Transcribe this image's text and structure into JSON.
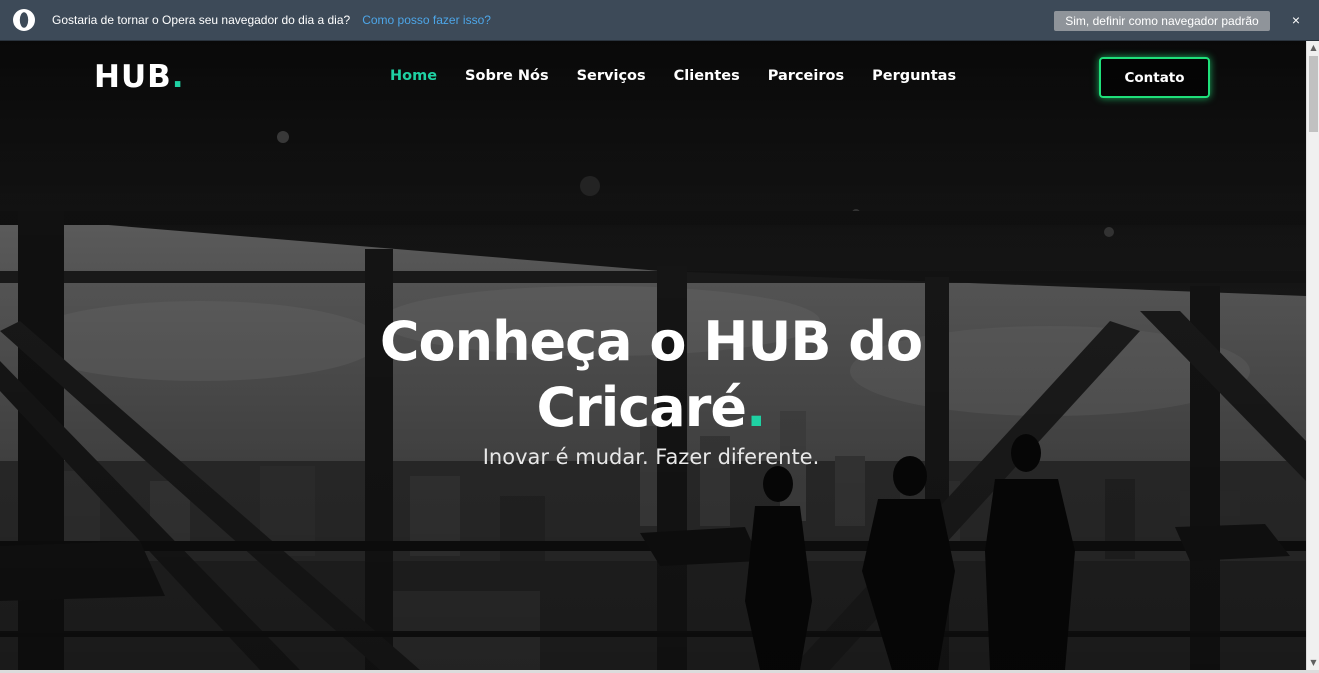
{
  "infobar": {
    "message": "Gostaria de tornar o Opera seu navegador do dia a dia?",
    "link": "Como posso fazer isso?",
    "button": "Sim, definir como navegador padrão",
    "close": "×",
    "icon": "opera-logo-icon"
  },
  "navbar": {
    "logo_text": "HUB",
    "logo_dot": ".",
    "links": [
      {
        "label": "Home",
        "active": true
      },
      {
        "label": "Sobre Nós",
        "active": false
      },
      {
        "label": "Serviços",
        "active": false
      },
      {
        "label": "Clientes",
        "active": false
      },
      {
        "label": "Parceiros",
        "active": false
      },
      {
        "label": "Perguntas",
        "active": false
      }
    ],
    "contact": "Contato"
  },
  "hero": {
    "title_line1": "Conheça o HUB do",
    "title_line2": "Cricaré",
    "title_dot": ".",
    "subtitle": "Inovar é mudar. Fazer diferente."
  },
  "colors": {
    "accent": "#1fd1a3",
    "contact_border": "#1fe07a",
    "infobar_bg": "#3d4a58",
    "link": "#4da6e8"
  }
}
